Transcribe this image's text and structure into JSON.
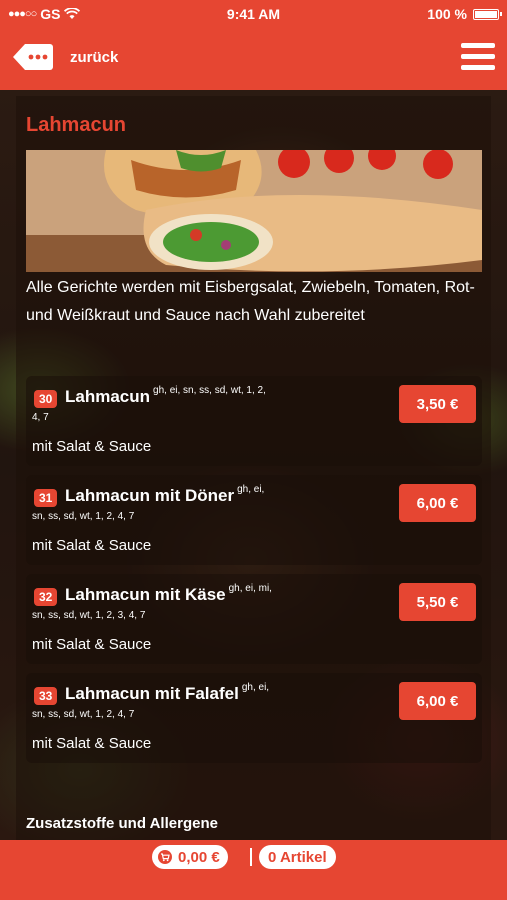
{
  "status_bar": {
    "carrier": "GS",
    "time": "9:41 AM",
    "battery": "100 %"
  },
  "nav": {
    "back_label": "zurück",
    "back_icon": "back-bubble-icon",
    "menu_icon": "hamburger-menu-icon"
  },
  "category": {
    "title": "Lahmacun",
    "description": "Alle Gerichte werden mit Eisbergsalat, Zwiebeln, Tomaten, Rot- und Weißkraut und Sauce nach Wahl zubereitet"
  },
  "items": [
    {
      "number": "30",
      "name": "Lahmacun",
      "codes_inline": "gh, ei, sn, ss, sd, wt, 1, 2,",
      "codes_line2": "4, 7",
      "subtitle": "mit Salat & Sauce",
      "price": "3,50 €"
    },
    {
      "number": "31",
      "name": "Lahmacun mit Döner",
      "codes_inline": "gh, ei,",
      "codes_line2": "sn, ss, sd, wt, 1, 2, 4, 7",
      "subtitle": "mit Salat & Sauce",
      "price": "6,00 €"
    },
    {
      "number": "32",
      "name": "Lahmacun mit Käse",
      "codes_inline": "gh, ei, mi,",
      "codes_line2": "sn, ss, sd, wt, 1, 2, 3, 4, 7",
      "subtitle": "mit Salat & Sauce",
      "price": "5,50 €"
    },
    {
      "number": "33",
      "name": "Lahmacun mit Falafel",
      "codes_inline": "gh, ei,",
      "codes_line2": "sn, ss, sd, wt, 1, 2, 4, 7",
      "subtitle": "mit Salat & Sauce",
      "price": "6,00 €"
    }
  ],
  "footer_link": "Zusatzstoffe und Allergene",
  "cart": {
    "total": "0,00 €",
    "articles": "0 Artikel",
    "cart_icon": "shopping-cart-icon"
  },
  "colors": {
    "accent": "#e64632"
  }
}
